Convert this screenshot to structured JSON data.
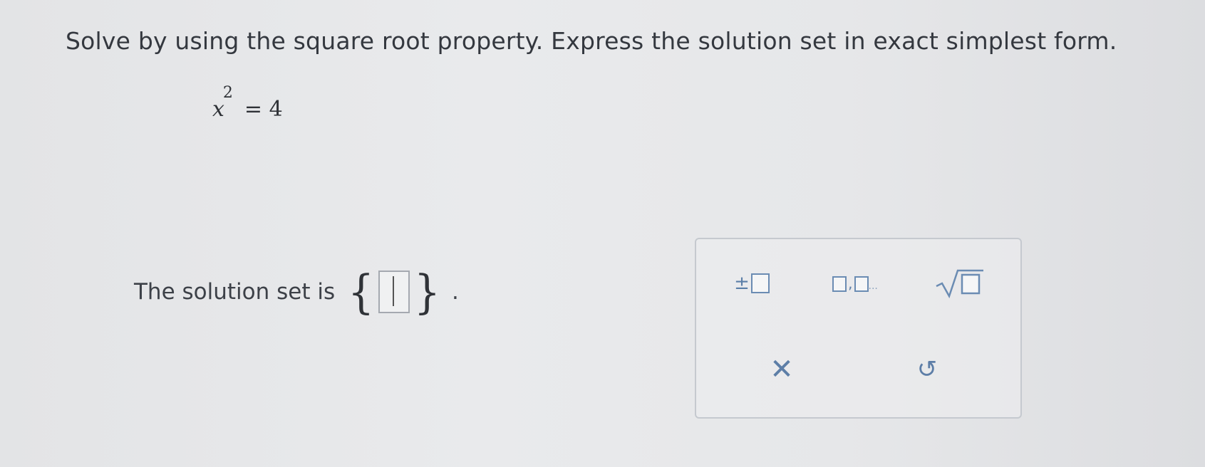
{
  "question": {
    "instruction": "Solve by using the square root property. Express the solution set in exact simplest form."
  },
  "equation": {
    "variable": "x",
    "exponent": "2",
    "right_side": "= 4"
  },
  "answer": {
    "prefix": "The solution set is",
    "brace_open": "{",
    "brace_close": "}",
    "value": "",
    "suffix": "."
  },
  "palette": {
    "tools": [
      {
        "icon": "plus-minus-box-icon",
        "symbol": "±"
      },
      {
        "icon": "list-boxes-icon",
        "separator": ",",
        "ellipsis": "..."
      },
      {
        "icon": "square-root-icon"
      },
      {
        "icon": "close-icon",
        "symbol": "✕"
      },
      {
        "icon": "undo-icon",
        "symbol": "↺"
      }
    ]
  },
  "colors": {
    "tool_accent": "#5b7fa8",
    "background": "#e6e7e9",
    "text": "#34383f"
  }
}
